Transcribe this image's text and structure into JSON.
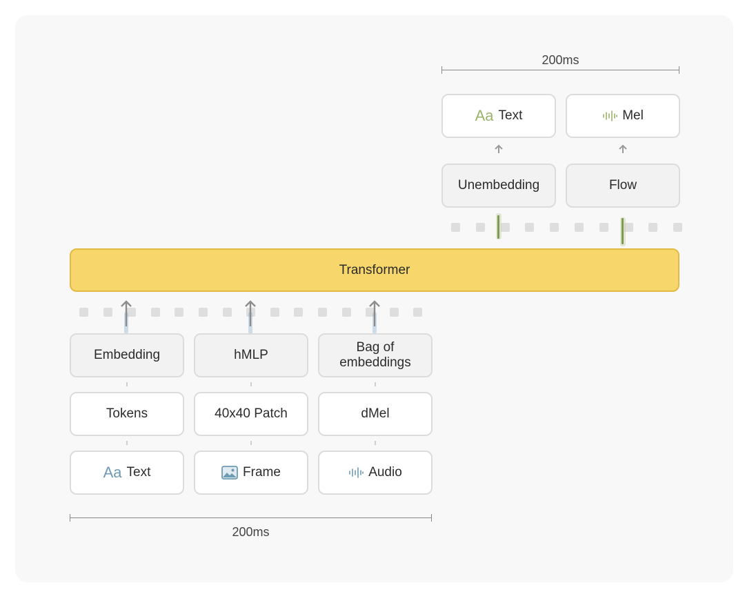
{
  "output": {
    "span_label": "200ms",
    "heads": [
      {
        "label": "Unembedding"
      },
      {
        "label": "Flow"
      }
    ],
    "outputs": [
      {
        "prefix": "Aa",
        "label": "Text",
        "icon": "text-aa-icon"
      },
      {
        "label": "Mel",
        "icon": "waveform-icon"
      }
    ]
  },
  "transformer": {
    "label": "Transformer"
  },
  "input": {
    "span_label": "200ms",
    "columns": [
      {
        "encoder": "Embedding",
        "representation": "Tokens",
        "modality": "Text",
        "prefix": "Aa",
        "icon": "text-aa-icon"
      },
      {
        "encoder": "hMLP",
        "representation": "40x40 Patch",
        "modality": "Frame",
        "icon": "image-icon"
      },
      {
        "encoder": "Bag of embeddings",
        "representation": "dMel",
        "modality": "Audio",
        "icon": "waveform-icon"
      }
    ]
  },
  "colors": {
    "transformer_fill": "#f7d66b",
    "input_accent": "#6f9ab3",
    "output_accent": "#9bb36b"
  }
}
